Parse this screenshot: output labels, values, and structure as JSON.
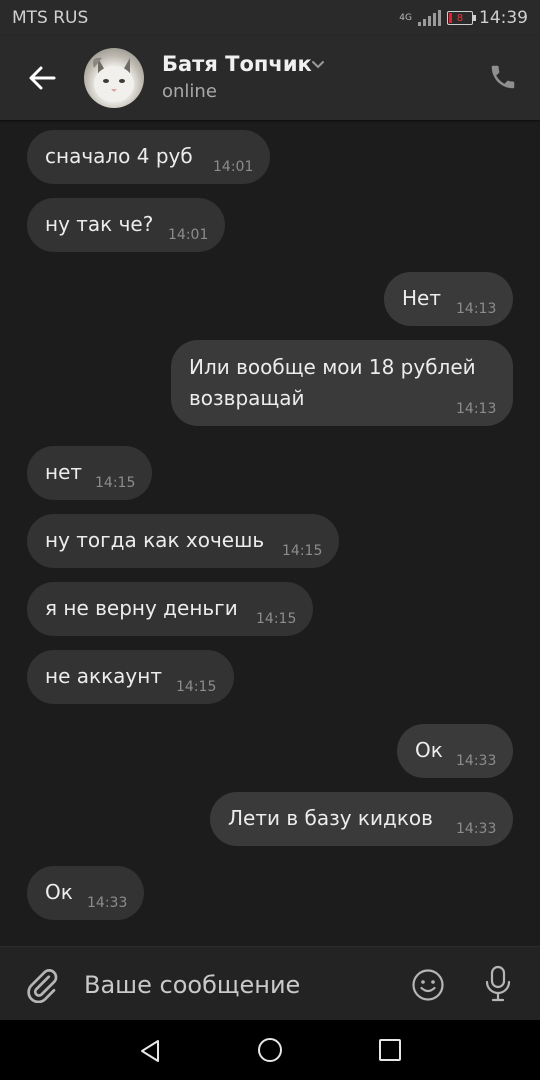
{
  "status_bar": {
    "carrier": "MTS RUS",
    "network_type": "4G",
    "battery_level": "8",
    "time": "14:39"
  },
  "header": {
    "contact_name": "Батя Топчик",
    "contact_status": "online"
  },
  "messages": [
    {
      "direction": "incoming",
      "text": "сначало 4 руб",
      "time": "14:01"
    },
    {
      "direction": "incoming",
      "text": "ну так че?",
      "time": "14:01"
    },
    {
      "direction": "outgoing",
      "text": "Нет",
      "time": "14:13"
    },
    {
      "direction": "outgoing",
      "text": "Или вообще мои 18 рублей возвращай",
      "time": "14:13"
    },
    {
      "direction": "incoming",
      "text": "нет",
      "time": "14:15"
    },
    {
      "direction": "incoming",
      "text": "ну тогда как хочешь",
      "time": "14:15"
    },
    {
      "direction": "incoming",
      "text": "я не верну деньги",
      "time": "14:15"
    },
    {
      "direction": "incoming",
      "text": "не аккаунт",
      "time": "14:15"
    },
    {
      "direction": "outgoing",
      "text": "Ок",
      "time": "14:33"
    },
    {
      "direction": "outgoing",
      "text": "Лети в базу кидков",
      "time": "14:33"
    },
    {
      "direction": "incoming",
      "text": "Ок",
      "time": "14:33"
    }
  ],
  "composer": {
    "placeholder": "Ваше сообщение"
  },
  "colors": {
    "background": "#1c1c1c",
    "header": "#2a2a2a",
    "bubble": "#3a3a3a",
    "muted_text": "#8c8c8c"
  }
}
